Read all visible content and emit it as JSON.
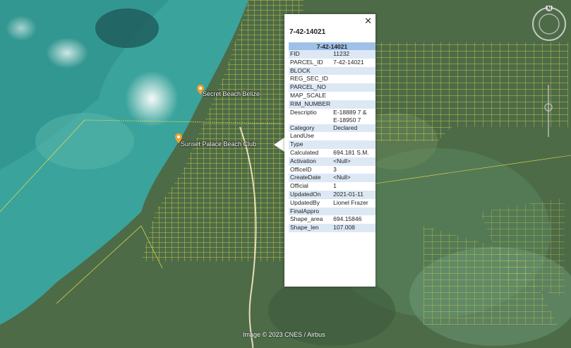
{
  "map": {
    "places": [
      {
        "name": "Secret Beach Belize"
      },
      {
        "name": "Sunset Palace Beach Club"
      }
    ],
    "attribution": "Image © 2023 CNES / Airbus",
    "compass_letter": "N"
  },
  "popup": {
    "close_label": "✕",
    "title": "7-42-14021",
    "table_header": "7-42-14021",
    "rows": [
      {
        "key": "FID",
        "value": "11232"
      },
      {
        "key": "PARCEL_ID",
        "value": "7-42-14021"
      },
      {
        "key": "BLOCK",
        "value": ""
      },
      {
        "key": "REG_SEC_ID",
        "value": ""
      },
      {
        "key": "PARCEL_NO",
        "value": ""
      },
      {
        "key": "MAP_SCALE",
        "value": ""
      },
      {
        "key": "RIM_NUMBER",
        "value": ""
      },
      {
        "key": "Descriptio",
        "value": "E-18889 7 &\nE-18950 7"
      },
      {
        "key": "Category",
        "value": "Declared"
      },
      {
        "key": "LandUse",
        "value": ""
      },
      {
        "key": "Type",
        "value": ""
      },
      {
        "key": "Calculated",
        "value": "694.181 S.M."
      },
      {
        "key": "Activation",
        "value": "<Null>"
      },
      {
        "key": "OfficeID",
        "value": "3"
      },
      {
        "key": "CreateDate",
        "value": "<Null>"
      },
      {
        "key": "Official",
        "value": "1"
      },
      {
        "key": "UpdatedOn",
        "value": "2021-01-11"
      },
      {
        "key": "UpdatedBy",
        "value": "Lionel Frazer"
      },
      {
        "key": "FinalAppro",
        "value": ""
      },
      {
        "key": "Shape_area",
        "value": "694.15846"
      },
      {
        "key": "Shape_len",
        "value": "107.008"
      }
    ]
  },
  "colors": {
    "parcel_line": "#e8e04a",
    "sea": "#3fa39a",
    "land": "#4c6e48"
  }
}
